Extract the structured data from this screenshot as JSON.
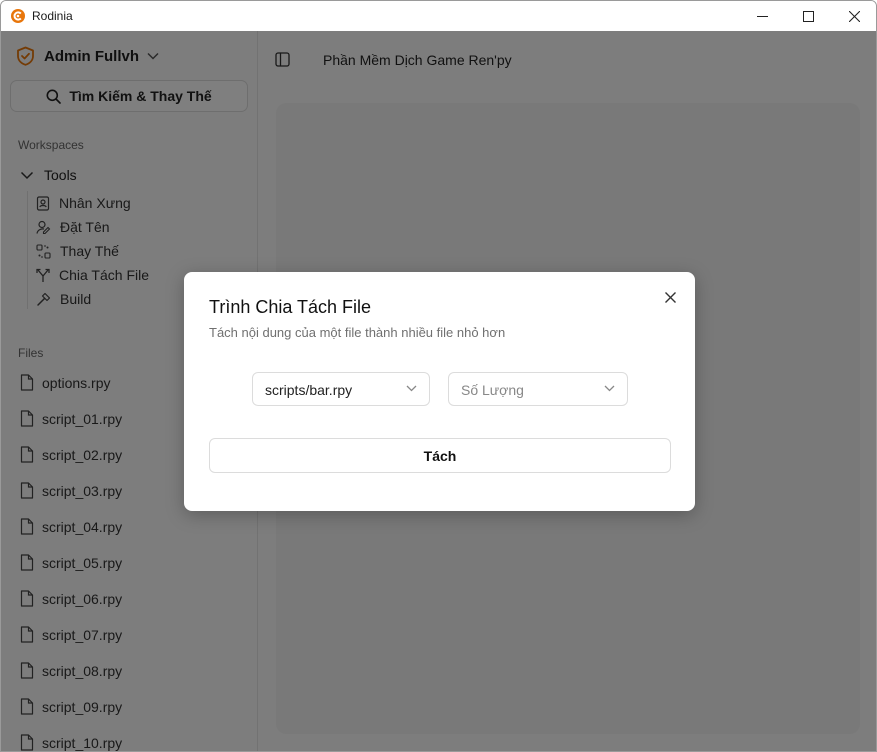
{
  "window": {
    "title": "Rodinia",
    "brand_color": "#e8760b"
  },
  "sidebar": {
    "user_name": "Admin Fullvh",
    "search_label": "Tìm Kiếm & Thay Thế",
    "workspaces_label": "Workspaces",
    "tools": {
      "label": "Tools",
      "items": [
        {
          "label": "Nhân Xưng",
          "icon": "contact-badge-icon"
        },
        {
          "label": "Đặt Tên",
          "icon": "user-pen-icon"
        },
        {
          "label": "Thay Thế",
          "icon": "replace-icon"
        },
        {
          "label": "Chia Tách File",
          "icon": "split-icon"
        },
        {
          "label": "Build",
          "icon": "hammer-icon"
        }
      ]
    },
    "files_label": "Files",
    "files": [
      "options.rpy",
      "script_01.rpy",
      "script_02.rpy",
      "script_03.rpy",
      "script_04.rpy",
      "script_05.rpy",
      "script_06.rpy",
      "script_07.rpy",
      "script_08.rpy",
      "script_09.rpy",
      "script_10.rpy"
    ]
  },
  "main": {
    "title": "Phần Mềm Dịch Game Ren'py"
  },
  "dialog": {
    "title": "Trình Chia Tách File",
    "description": "Tách nội dung của một file thành nhiều file nhỏ hơn",
    "file_select_value": "scripts/bar.rpy",
    "quantity_placeholder": "Số Lượng",
    "action_label": "Tách"
  }
}
